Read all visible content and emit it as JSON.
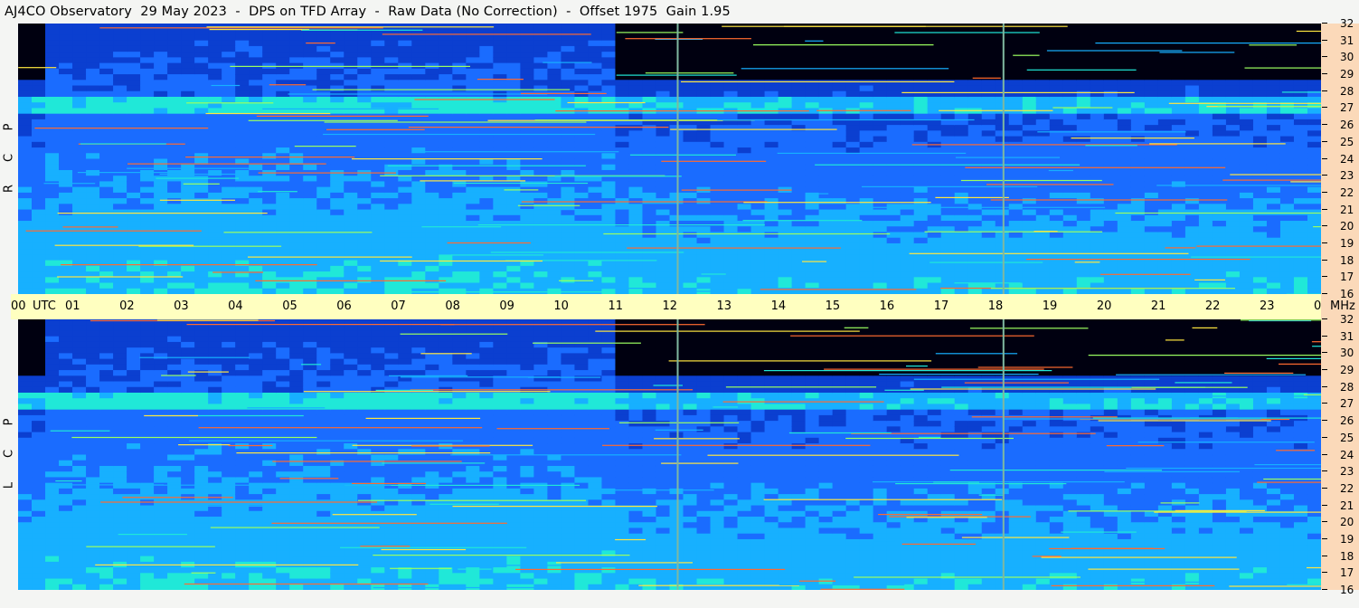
{
  "title": "AJ4CO Observatory  29 May 2023  -  DPS on TFD Array  -  Raw Data (No Correction)  -  Offset 1975  Gain 1.95",
  "panels": [
    {
      "id": "rcp",
      "letters": [
        "P",
        "C",
        "R"
      ]
    },
    {
      "id": "lcp",
      "letters": [
        "P",
        "C",
        "L"
      ]
    }
  ],
  "utc_label": "UTC",
  "mhz_label": "MHz",
  "colors": {
    "background": "#f4f5f3",
    "utc_strip": "#ffffc0",
    "freq_strip": "#fbd9b9",
    "gap_marker": "#7fb8a0"
  },
  "chart_data": {
    "type": "heatmap",
    "title": "AJ4CO Observatory  29 May 2023  -  DPS on TFD Array  -  Raw Data (No Correction)  -  Offset 1975  Gain 1.95",
    "xlabel": "UTC",
    "ylabel": "MHz",
    "x_ticks": [
      "00",
      "01",
      "02",
      "03",
      "04",
      "05",
      "06",
      "07",
      "08",
      "09",
      "10",
      "11",
      "12",
      "13",
      "14",
      "15",
      "16",
      "17",
      "18",
      "19",
      "20",
      "21",
      "22",
      "23",
      "00"
    ],
    "y_ticks": [
      "32",
      "31",
      "30",
      "29",
      "28",
      "27",
      "26",
      "25",
      "24",
      "23",
      "22",
      "21",
      "20",
      "19",
      "18",
      "17",
      "16"
    ],
    "xlim": [
      0,
      24
    ],
    "ylim": [
      16,
      32
    ],
    "series": [
      {
        "name": "RCP"
      },
      {
        "name": "LCP"
      }
    ],
    "gap_markers_utc": [
      12.15,
      18.15
    ],
    "colormap": [
      "#000010",
      "#001a6a",
      "#0b3fd0",
      "#1a6cff",
      "#17b0ff",
      "#20e8d8",
      "#9aff60",
      "#ffe640",
      "#ff6a30",
      "#e0009a"
    ]
  }
}
